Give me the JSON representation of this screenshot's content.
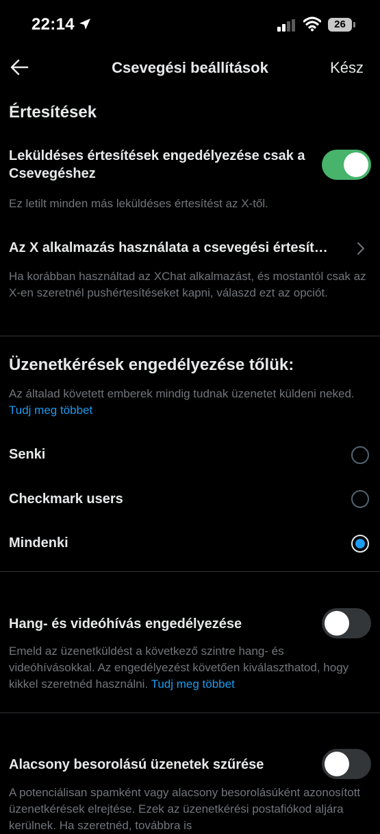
{
  "status_bar": {
    "time": "22:14",
    "battery": "26"
  },
  "header": {
    "title": "Csevegési beállítások",
    "done_label": "Kész"
  },
  "notifications": {
    "section_title": "Értesítések",
    "push_only_chat": {
      "title": "Leküldéses értesítések engedélyezése csak a Csevegéshez",
      "description": "Ez letilt minden más leküldéses értesítést az X-től.",
      "enabled": true
    },
    "use_x_app": {
      "title": "Az X alkalmazás használata a csevegési értesít…",
      "description": "Ha korábban használtad az XChat alkalmazást, és mostantól csak az X-en szeretnél pushértesítéseket kapni, válaszd ezt az opciót."
    }
  },
  "message_requests": {
    "section_title": "Üzenetkérések engedélyezése tőlük:",
    "description": "Az általad követett emberek mindig tudnak üzenetet küldeni neked.",
    "learn_more": "Tudj meg többet",
    "options": [
      {
        "label": "Senki",
        "selected": false
      },
      {
        "label": "Checkmark users",
        "selected": false
      },
      {
        "label": "Mindenki",
        "selected": true
      }
    ]
  },
  "calls": {
    "title": "Hang- és videóhívás engedélyezése",
    "description": "Emeld az üzenetküldést a következő szintre hang- és videóhívásokkal. Az engedélyezést követően kiválaszthatod, hogy kikkel szeretnéd használni.",
    "learn_more": "Tudj meg többet",
    "enabled": false
  },
  "low_quality": {
    "title": "Alacsony besorolású üzenetek szűrése",
    "description": "A potenciálisan spamként vagy alacsony besorolásúként azonosított üzenetkérések elrejtése. Ezek az üzenetkérési postafiókod aljára kerülnek. Ha szeretnéd, továbbra is",
    "enabled": false
  },
  "colors": {
    "background": "#000000",
    "accent": "#1d9bf0",
    "toggle_on": "#47b36b",
    "secondary_text": "#71767b"
  },
  "icons": [
    "location-arrow-icon",
    "cellular-signal-icon",
    "wifi-icon",
    "battery-icon",
    "back-arrow-icon",
    "chevron-right-icon"
  ]
}
